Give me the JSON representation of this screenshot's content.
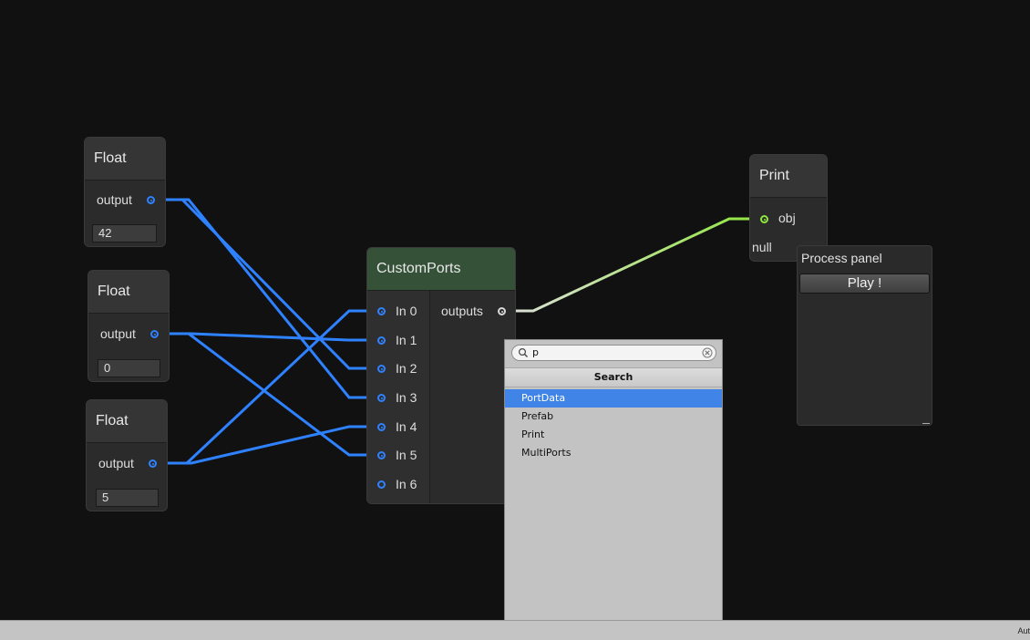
{
  "nodes": {
    "float1": {
      "title": "Float",
      "port": "output",
      "value": "42"
    },
    "float2": {
      "title": "Float",
      "port": "output",
      "value": "0"
    },
    "float3": {
      "title": "Float",
      "port": "output",
      "value": "5"
    },
    "custom_ports": {
      "title": "CustomPorts",
      "inputs": [
        "In 0",
        "In 1",
        "In 2",
        "In 3",
        "In 4",
        "In 5",
        "In 6"
      ],
      "output": "outputs"
    },
    "print": {
      "title": "Print",
      "port": "obj",
      "value": "null"
    }
  },
  "process_panel": {
    "title": "Process panel",
    "play_label": "Play !"
  },
  "search": {
    "query": "p",
    "header": "Search",
    "results": [
      "PortData",
      "Prefab",
      "Print",
      "MultiPorts"
    ],
    "selected": "PortData"
  },
  "status_bar": {
    "text": "Aut"
  },
  "colors": {
    "canvas": "#111111",
    "wire_blue": "#2f82ff",
    "wire_green": "#8ee63a",
    "header_green": "#355239",
    "selection": "#3f84e6"
  }
}
